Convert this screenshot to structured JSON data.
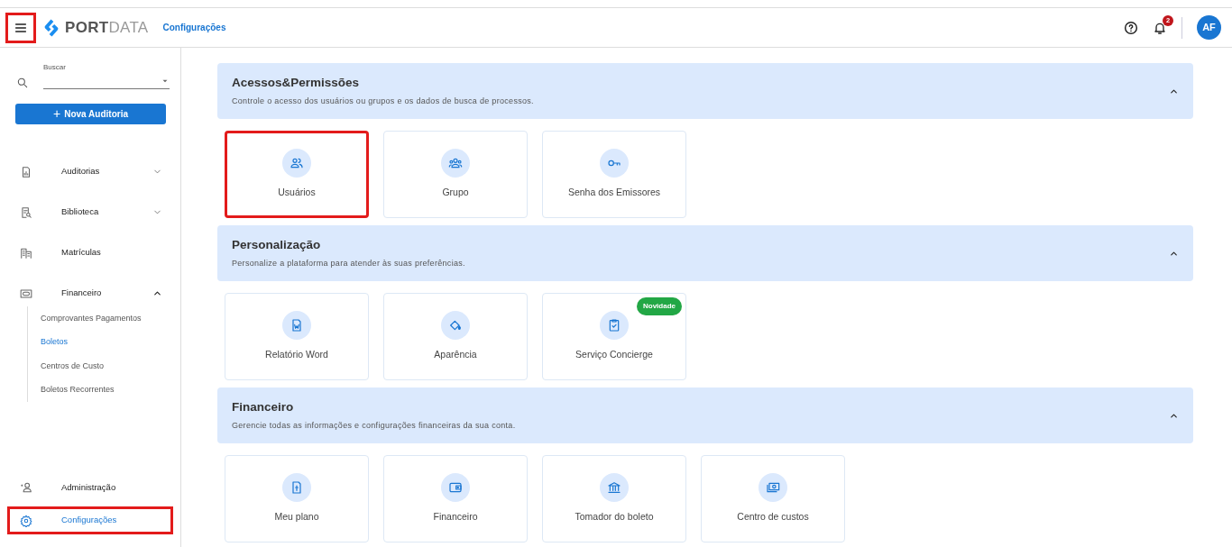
{
  "header": {
    "menu_button": {
      "highlighted": true
    },
    "logo_text": [
      "PORT",
      "DATA"
    ],
    "page_title": "Configurações",
    "notifications": {
      "count": "2"
    },
    "avatar": "AF"
  },
  "sidebar": {
    "search": {
      "label": "Buscar"
    },
    "new_button": {
      "icon": "+",
      "label": "Nova Auditoria"
    },
    "items": [
      {
        "label": "Auditorias",
        "kind": "group",
        "expanded": false,
        "selected": false,
        "highlighted": false
      },
      {
        "label": "Biblioteca",
        "kind": "group",
        "expanded": false,
        "selected": false,
        "highlighted": false
      },
      {
        "label": "Matrículas",
        "kind": "link",
        "selected": false,
        "highlighted": false
      },
      {
        "label": "Financeiro",
        "kind": "group",
        "expanded": true,
        "selected": false,
        "highlighted": false,
        "children": [
          {
            "label": "Comprovantes Pagamentos",
            "selected": false
          },
          {
            "label": "Boletos",
            "selected": true
          },
          {
            "label": "Centros de Custo",
            "selected": false
          },
          {
            "label": "Boletos Recorrentes",
            "selected": false
          }
        ]
      }
    ],
    "bottom_items": [
      {
        "label": "Administração",
        "selected": false,
        "highlighted": false
      },
      {
        "label": "Configurações",
        "selected": true,
        "highlighted": true
      }
    ]
  },
  "sections": [
    {
      "title": "Acessos&Permissões",
      "description": "Controle o acesso dos usuários ou grupos e os dados de busca de processos.",
      "expanded": true,
      "cards": [
        {
          "label": "Usuários",
          "highlighted": true
        },
        {
          "label": "Grupo",
          "highlighted": false
        },
        {
          "label": "Senha dos Emissores",
          "highlighted": false
        }
      ]
    },
    {
      "title": "Personalização",
      "description": "Personalize a plataforma para atender às suas preferências.",
      "expanded": true,
      "cards": [
        {
          "label": "Relatório Word",
          "highlighted": false
        },
        {
          "label": "Aparência",
          "highlighted": false
        },
        {
          "label": "Serviço Concierge",
          "highlighted": false,
          "badge": "Novidade"
        }
      ]
    },
    {
      "title": "Financeiro",
      "description": "Gerencie todas as informações e configurações financeiras da sua conta.",
      "expanded": true,
      "cards": [
        {
          "label": "Meu plano",
          "highlighted": false
        },
        {
          "label": "Financeiro",
          "highlighted": false
        },
        {
          "label": "Tomador do boleto",
          "highlighted": false
        },
        {
          "label": "Centro de custos",
          "highlighted": false
        }
      ]
    }
  ]
}
